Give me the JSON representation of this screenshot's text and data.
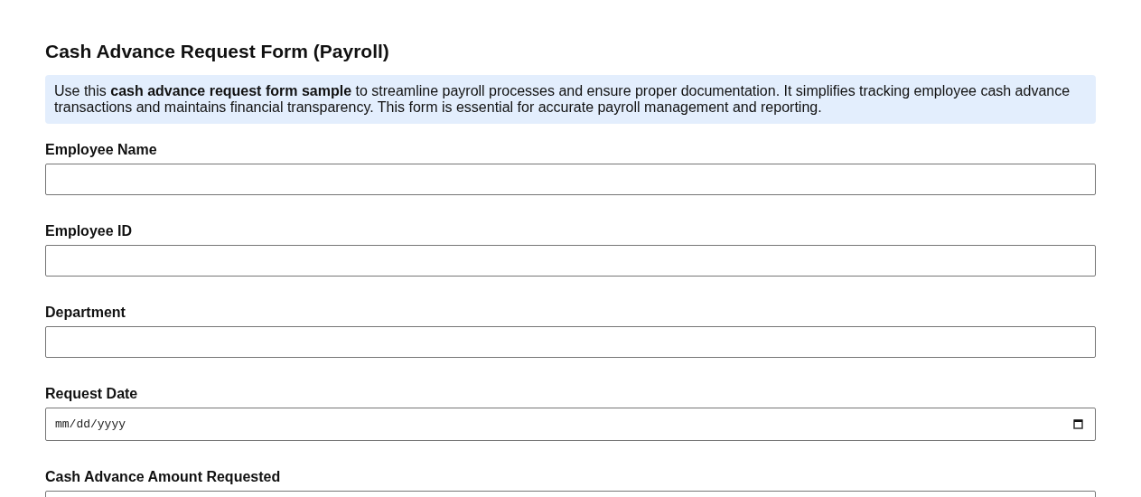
{
  "title": "Cash Advance Request Form (Payroll)",
  "intro": "Use this **cash advance request form sample** to streamline payroll processes and ensure proper documentation. It simplifies tracking employee cash advance transactions and maintains financial transparency. This form is essential for accurate payroll management and reporting.",
  "fields": [
    {
      "label": "Employee Name",
      "kind": "text"
    },
    {
      "label": "Employee ID",
      "kind": "text"
    },
    {
      "label": "Department",
      "kind": "text"
    },
    {
      "label": "Request Date",
      "kind": "date",
      "placeholder": "mm/dd/yyyy"
    },
    {
      "label": "Cash Advance Amount Requested",
      "kind": "text"
    }
  ]
}
